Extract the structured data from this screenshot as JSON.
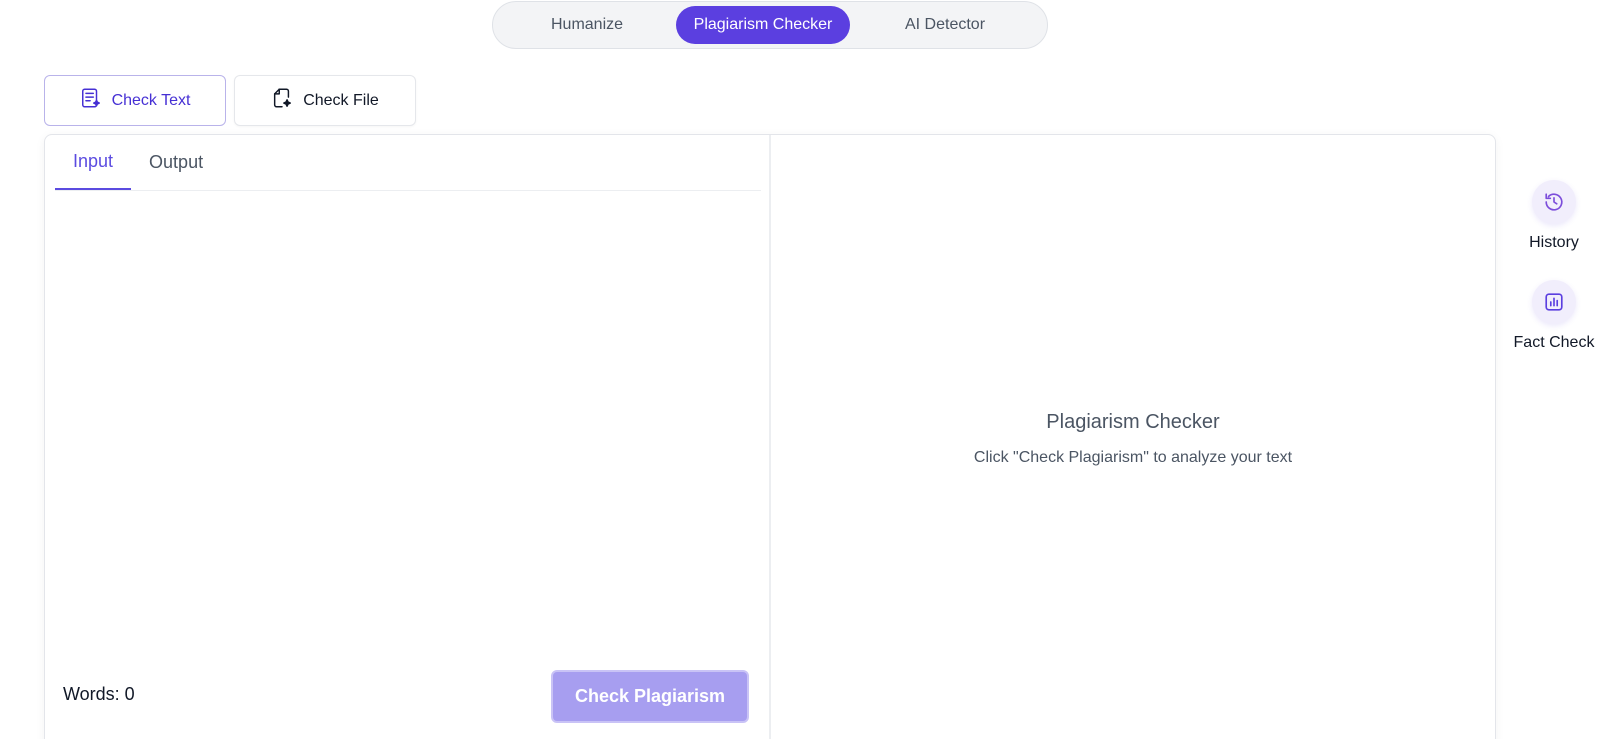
{
  "mode_switch": {
    "tabs": [
      {
        "label": "Humanize"
      },
      {
        "label": "Plagiarism Checker"
      },
      {
        "label": "AI Detector"
      }
    ],
    "active": "Plagiarism Checker"
  },
  "check_tabs": {
    "text_label": "Check Text",
    "text_icon": "text-document-icon",
    "file_label": "Check File",
    "file_icon": "file-sparkle-icon"
  },
  "editor": {
    "tabs": [
      {
        "label": "Input"
      },
      {
        "label": "Output"
      }
    ],
    "active_tab": "Input",
    "input_value": "",
    "words_label": "Words: 0",
    "check_button_label": "Check Plagiarism"
  },
  "result": {
    "title": "Plagiarism Checker",
    "subtitle": "Click \"Check Plagiarism\" to analyze your text"
  },
  "sidebar": {
    "items": [
      {
        "label": "History",
        "icon": "history-icon"
      },
      {
        "label": "Fact Check",
        "icon": "chart-icon"
      }
    ]
  },
  "colors": {
    "accent": "#5b3fe0",
    "button_disabled": "#a79ef0",
    "switch_bg": "#f3f4f6"
  }
}
